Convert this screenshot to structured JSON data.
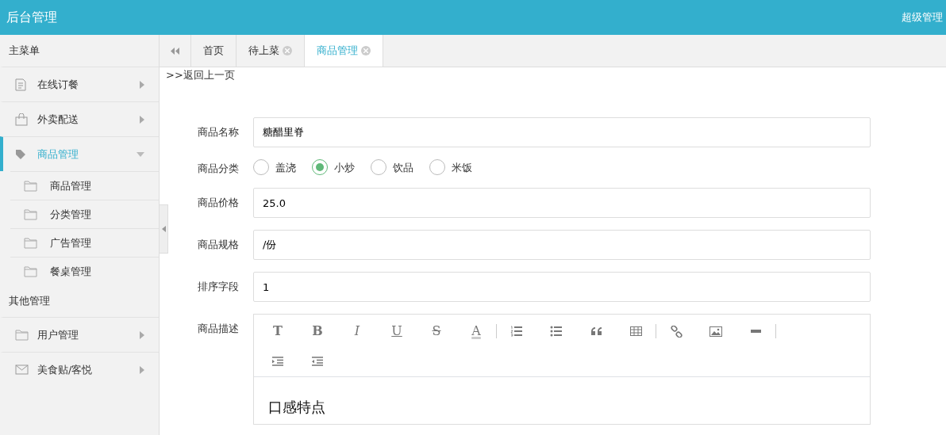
{
  "header": {
    "title": "后台管理",
    "user": "超级管理"
  },
  "sidebar": {
    "sections": [
      {
        "title": "主菜单",
        "items": [
          {
            "label": "在线订餐",
            "kind": "document",
            "selected": false,
            "expanded": false
          },
          {
            "label": "外卖配送",
            "kind": "bag",
            "selected": false,
            "expanded": false
          },
          {
            "label": "商品管理",
            "kind": "tag",
            "selected": true,
            "expanded": true,
            "children": [
              {
                "label": "商品管理"
              },
              {
                "label": "分类管理"
              },
              {
                "label": "广告管理"
              },
              {
                "label": "餐桌管理"
              }
            ]
          }
        ]
      },
      {
        "title": "其他管理",
        "items": [
          {
            "label": "用户管理",
            "kind": "folder",
            "selected": false,
            "expanded": false
          },
          {
            "label": "美食贴/客悦",
            "kind": "mail",
            "selected": false,
            "expanded": false
          }
        ]
      }
    ]
  },
  "tabs": [
    {
      "label": "首页",
      "selected": false,
      "closable": false
    },
    {
      "label": "待上菜",
      "selected": false,
      "closable": true
    },
    {
      "label": "商品管理",
      "selected": true,
      "closable": true
    }
  ],
  "back_link": ">>返回上一页",
  "form": [
    {
      "kind": "text",
      "label": "商品名称",
      "value": "糖醋里脊"
    },
    {
      "kind": "radio",
      "label": "商品分类",
      "options": [
        {
          "label": "盖浇",
          "selected": false
        },
        {
          "label": "小炒",
          "selected": true
        },
        {
          "label": "饮品",
          "selected": false
        },
        {
          "label": "米饭",
          "selected": false
        }
      ]
    },
    {
      "kind": "text",
      "label": "商品价格",
      "value": "25.0"
    },
    {
      "kind": "text",
      "label": "商品规格",
      "value": "/份"
    },
    {
      "kind": "text",
      "label": "排序字段",
      "value": "1"
    },
    {
      "kind": "editor",
      "label": "商品描述",
      "toolbar": [
        {
          "kind": "heading",
          "text": "T"
        },
        {
          "kind": "bold",
          "text": "B"
        },
        {
          "kind": "italic",
          "text": "I"
        },
        {
          "kind": "underline",
          "text": "U"
        },
        {
          "kind": "strike",
          "text": "S"
        },
        {
          "kind": "color",
          "text": "A"
        },
        {
          "kind": "separator"
        },
        {
          "kind": "ordered-list"
        },
        {
          "kind": "bullet-list"
        },
        {
          "kind": "quote"
        },
        {
          "kind": "table"
        },
        {
          "kind": "separator"
        },
        {
          "kind": "link"
        },
        {
          "kind": "image"
        },
        {
          "kind": "rule"
        },
        {
          "kind": "separator"
        },
        {
          "kind": "break"
        },
        {
          "kind": "indent"
        },
        {
          "kind": "outdent"
        }
      ],
      "content": "口感特点"
    }
  ]
}
